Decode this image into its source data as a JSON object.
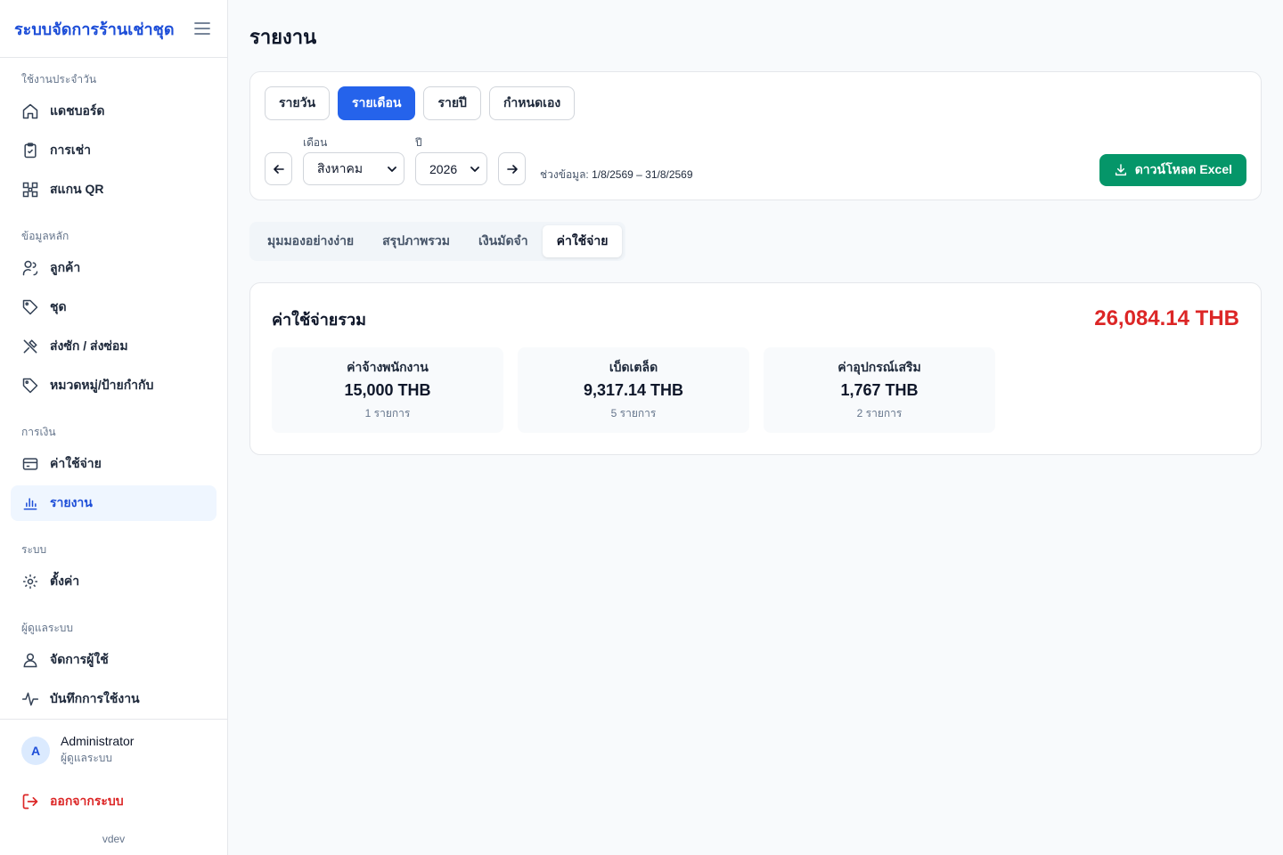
{
  "app": {
    "title": "ระบบจัดการร้านเช่าชุด"
  },
  "sidebar": {
    "sections": [
      {
        "label": "ใช้งานประจำวัน"
      },
      {
        "label": "ข้อมูลหลัก"
      },
      {
        "label": "การเงิน"
      },
      {
        "label": "ระบบ"
      },
      {
        "label": "ผู้ดูแลระบบ"
      }
    ],
    "items": [
      {
        "label": "แดชบอร์ด",
        "icon": "home-icon"
      },
      {
        "label": "การเช่า",
        "icon": "clipboard-icon"
      },
      {
        "label": "สแกน QR",
        "icon": "qr-icon"
      },
      {
        "label": "ลูกค้า",
        "icon": "users-icon"
      },
      {
        "label": "ชุด",
        "icon": "tag-icon"
      },
      {
        "label": "ส่งซัก / ส่งซ่อม",
        "icon": "tools-icon"
      },
      {
        "label": "หมวดหมู่/ป้ายกำกับ",
        "icon": "tag-icon"
      },
      {
        "label": "ค่าใช้จ่าย",
        "icon": "credit-card-icon"
      },
      {
        "label": "รายงาน",
        "icon": "bar-chart-icon",
        "active": true
      },
      {
        "label": "ตั้งค่า",
        "icon": "gear-icon"
      },
      {
        "label": "จัดการผู้ใช้",
        "icon": "user-icon"
      },
      {
        "label": "บันทึกการใช้งาน",
        "icon": "activity-icon"
      }
    ],
    "user": {
      "initial": "A",
      "name": "Administrator",
      "role": "ผู้ดูแลระบบ"
    },
    "logout_label": "ออกจากระบบ",
    "version": "vdev"
  },
  "page": {
    "title": "รายงาน"
  },
  "filters": {
    "period_tabs": [
      {
        "label": "รายวัน"
      },
      {
        "label": "รายเดือน",
        "active": true
      },
      {
        "label": "รายปี"
      },
      {
        "label": "กำหนดเอง"
      }
    ],
    "month_label": "เดือน",
    "month_value": "สิงหาคม",
    "year_label": "ปี",
    "year_value": "2026",
    "range_label": "ช่วงข้อมูล:",
    "range_value": "1/8/2569 – 31/8/2569",
    "download_label": "ดาวน์โหลด Excel"
  },
  "view_tabs": [
    {
      "label": "มุมมองอย่างง่าย"
    },
    {
      "label": "สรุปภาพรวม"
    },
    {
      "label": "เงินมัดจำ"
    },
    {
      "label": "ค่าใช้จ่าย",
      "active": true
    }
  ],
  "summary": {
    "title": "ค่าใช้จ่ายรวม",
    "total": "26,084.14 THB",
    "stats": [
      {
        "label": "ค่าจ้างพนักงาน",
        "value": "15,000 THB",
        "count": "1 รายการ"
      },
      {
        "label": "เบ็ดเตล็ด",
        "value": "9,317.14 THB",
        "count": "5 รายการ"
      },
      {
        "label": "ค่าอุปกรณ์เสริม",
        "value": "1,767 THB",
        "count": "2 รายการ"
      }
    ]
  },
  "colors": {
    "primary": "#2563eb",
    "success": "#059669",
    "danger": "#dc2626"
  }
}
